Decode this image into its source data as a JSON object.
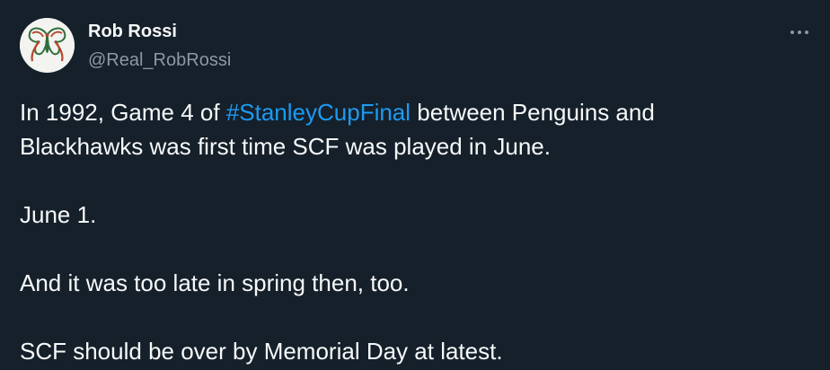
{
  "author": {
    "name": "Rob Rossi",
    "handle": "@Real_RobRossi",
    "avatar_icon": "butterfly-logo-icon"
  },
  "more_icon": "more-options-icon",
  "tweet": {
    "line1_before": "In 1992, Game 4 of ",
    "hashtag": "#StanleyCupFinal",
    "line1_after": " between Penguins and",
    "line2": "Blackhawks was first time SCF was played in June.",
    "line3": "June 1.",
    "line4": "And it was too late in spring then, too.",
    "line5": "SCF should be over by Memorial Day at latest."
  },
  "colors": {
    "background": "#15202b",
    "text": "#f7f9f9",
    "secondary": "#8b98a5",
    "link": "#1d9bf0"
  }
}
